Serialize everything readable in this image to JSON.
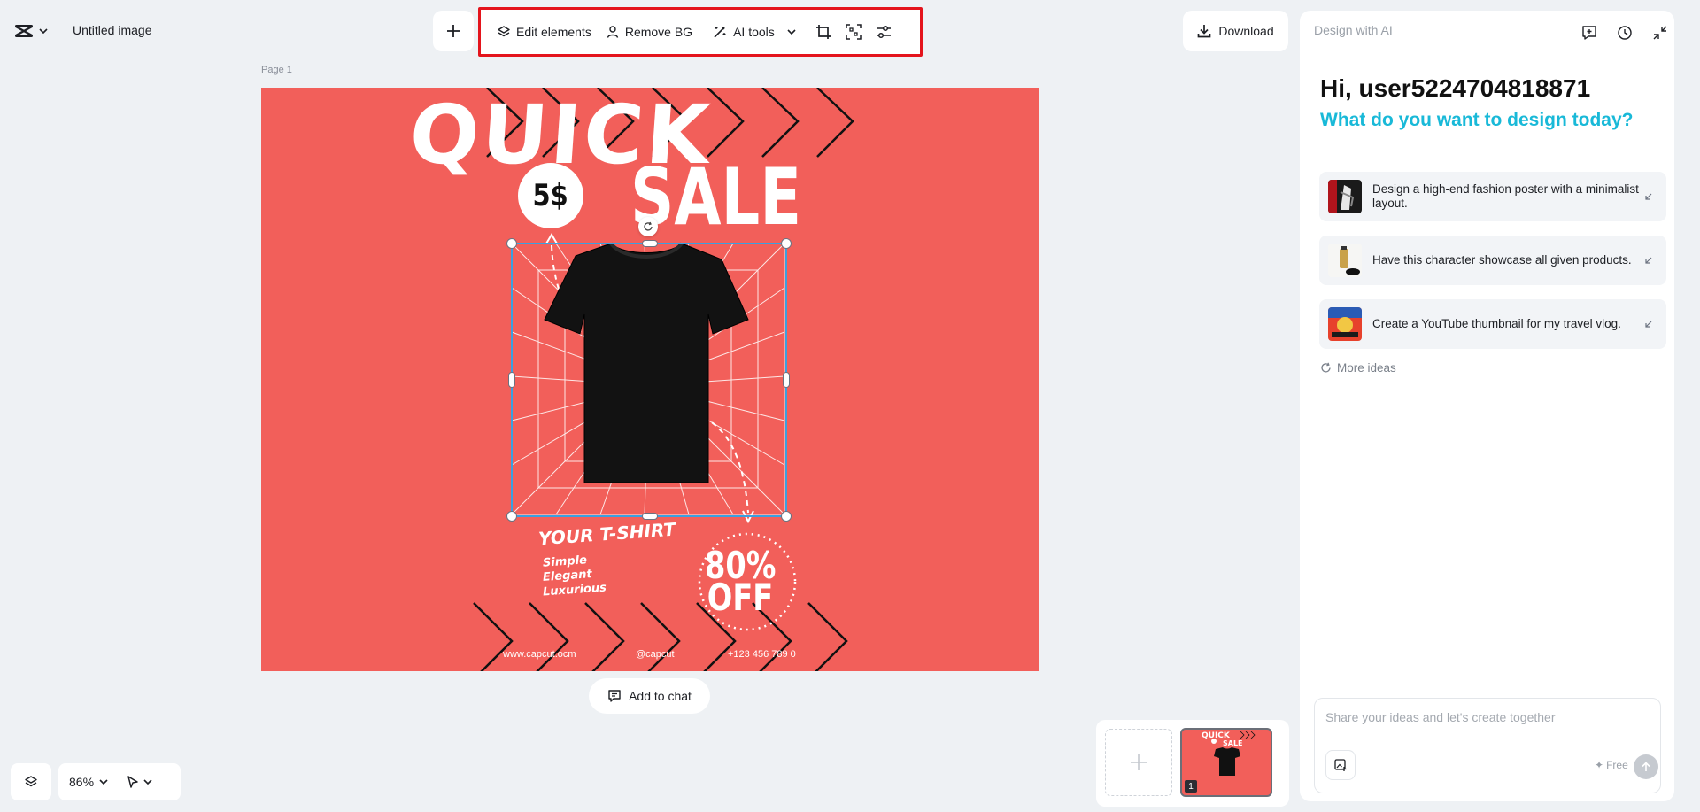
{
  "header": {
    "doc_title": "Untitled image"
  },
  "toolbar": {
    "edit_elements_label": "Edit elements",
    "remove_bg_label": "Remove BG",
    "ai_tools_label": "AI tools",
    "highlight_color": "#e4141c"
  },
  "download": {
    "label": "Download"
  },
  "canvas": {
    "page_label": "Page 1",
    "background_color": "#f25f5a",
    "poster": {
      "headline_1": "QUICK",
      "headline_2": "SALE",
      "price": "5$",
      "product_title": "YOUR T-SHIRT",
      "taglines": [
        "Simple",
        "Elegant",
        "Luxurious"
      ],
      "discount_line_1": "80%",
      "discount_line_2": "OFF",
      "website": "www.capcut.ocm",
      "handle": "@capcut",
      "phone": "+123 456 789 0"
    }
  },
  "add_to_chat": {
    "label": "Add to chat"
  },
  "bottom_bar": {
    "zoom": "86%"
  },
  "pages": {
    "current_page_number": "1"
  },
  "ai_panel": {
    "title": "Design with AI",
    "greeting": "Hi, user5224704818871",
    "subtitle": "What do you want to design today?",
    "accent_color": "#19b9d8",
    "suggestions": [
      {
        "text": "Design a high-end fashion poster with a minimalist layout."
      },
      {
        "text": "Have this character showcase all given products."
      },
      {
        "text": "Create a YouTube thumbnail for my travel vlog."
      }
    ],
    "more_ideas": "More ideas",
    "chat_placeholder": "Share your ideas and let's create together",
    "free_label": "Free"
  }
}
